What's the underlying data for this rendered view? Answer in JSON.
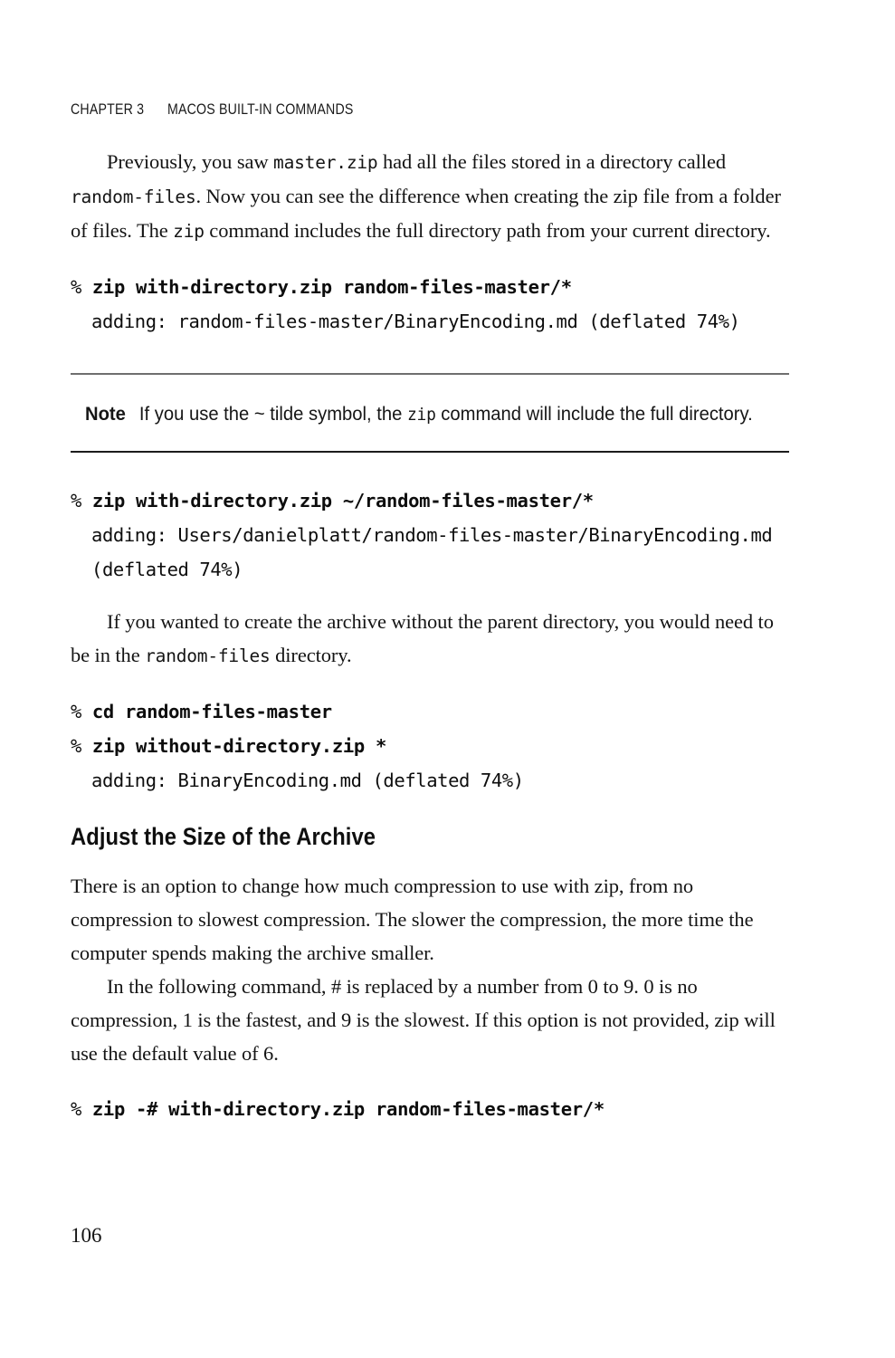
{
  "page": {
    "folio": "106",
    "running_head": {
      "chapter": "CHAPTER 3",
      "title": "MACOS BUILT-IN COMMANDS"
    }
  },
  "paragraphs": {
    "p1": {
      "seg1": "Previously, you saw ",
      "code1": "master.zip",
      "seg2": " had all the files stored in a directory called ",
      "code2": "random-files",
      "seg3": ". Now you can see the difference when creating the zip file from a folder of files. The ",
      "code3": "zip",
      "seg4": " command includes the full directory path from your current directory."
    },
    "p2": {
      "seg1": "If you wanted to create the archive without the parent directory, you would need to be in the ",
      "code1": "random-files",
      "seg2": " directory."
    },
    "p3": {
      "text": "There is an option to change how much compression to use with zip, from no compression to slowest compression. The slower the compression, the more time the computer spends making the archive smaller."
    },
    "p4": {
      "text": "In the following command, # is replaced by a number from 0 to 9. 0 is no compression, 1 is the fastest, and 9 is the slowest. If this option is not provided, zip will use the default value of 6."
    }
  },
  "code_blocks": {
    "block1": {
      "prompt": "% ",
      "command": "zip with-directory.zip random-files-master/*",
      "output": "adding: random-files-master/BinaryEncoding.md (deflated 74%)"
    },
    "block2": {
      "prompt": "% ",
      "command": "zip with-directory.zip ~/random-files-master/*",
      "output": "adding: Users/danielplatt/random-files-master/BinaryEncoding.md (deflated 74%)"
    },
    "block3": {
      "prompt1": "% ",
      "command1": "cd random-files-master",
      "prompt2": "% ",
      "command2": "zip without-directory.zip *",
      "output": "adding: BinaryEncoding.md (deflated 74%)"
    },
    "block4": {
      "prompt": "% ",
      "command": "zip -# with-directory.zip random-files-master/*"
    }
  },
  "note": {
    "label": "Note",
    "seg1": "If you use the ~ tilde symbol, the ",
    "code1": "zip",
    "seg2": " command will include the full directory."
  },
  "headings": {
    "adjust_size": "Adjust the Size of the Archive"
  }
}
